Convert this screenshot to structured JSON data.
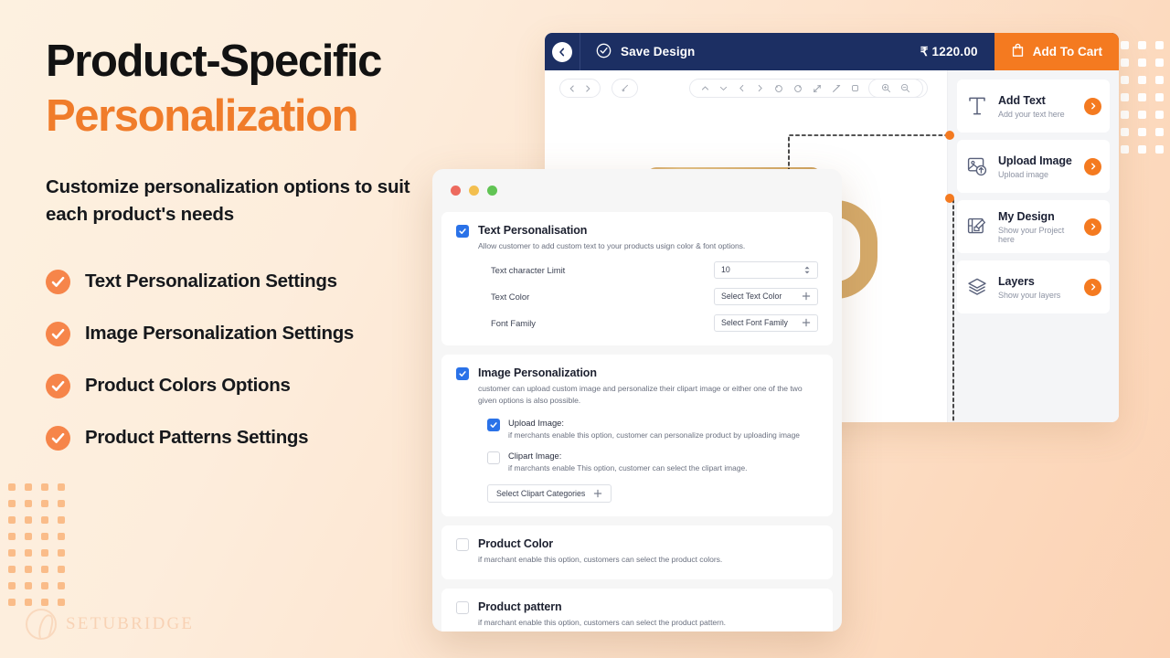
{
  "hero": {
    "headline_line1": "Product-Specific",
    "headline_line2": "Personalization",
    "subheadline": "Customize personalization options to suit each product's needs",
    "accent_color": "#f07c2a",
    "features": [
      {
        "label": "Text Personalization Settings",
        "icon": "check-circle-icon"
      },
      {
        "label": "Image Personalization Settings",
        "icon": "check-circle-icon"
      },
      {
        "label": "Product Colors Options",
        "icon": "check-circle-icon"
      },
      {
        "label": "Product Patterns Settings",
        "icon": "check-circle-icon"
      }
    ],
    "watermark": "SETUBRIDGE"
  },
  "app": {
    "topbar": {
      "back_icon": "chevron-left-icon",
      "save_icon": "cloud-check-icon",
      "save_label": "Save Design",
      "price": "₹ 1220.00",
      "cart_icon": "shopping-bag-icon",
      "cart_label": "Add To Cart",
      "bar_color": "#1c2f63",
      "cart_color": "#f47a20"
    },
    "toolbar": {
      "nav_icons": [
        "chevron-left-icon",
        "chevron-right-icon"
      ],
      "brush_icon": "brush-icon",
      "edit_icons": [
        "chevron-up-icon",
        "chevron-down-icon",
        "chevron-left-icon",
        "chevron-right-icon",
        "rotate-left-icon",
        "rotate-right-icon",
        "expand-diagonal-icon",
        "shrink-diagonal-icon",
        "square-icon",
        "copy-icon",
        "flip-vertical-icon",
        "flip-horizontal-icon"
      ],
      "zoom_icons": [
        "zoom-in-icon",
        "zoom-out-icon"
      ]
    },
    "panel_items": [
      {
        "title": "Add Text",
        "subtitle": "Add your text here",
        "icon": "text-tool-icon",
        "arrow": "chevron-right-icon"
      },
      {
        "title": "Upload Image",
        "subtitle": "Upload image",
        "icon": "image-upload-icon",
        "arrow": "chevron-right-icon"
      },
      {
        "title": "My Design",
        "subtitle": "Show your Project here",
        "icon": "blueprint-icon",
        "arrow": "chevron-right-icon"
      },
      {
        "title": "Layers",
        "subtitle": "Show your layers",
        "icon": "layers-icon",
        "arrow": "chevron-right-icon"
      }
    ],
    "product": {
      "name": "mug",
      "color": "#d5aa6a"
    }
  },
  "settings": {
    "window_dots": [
      "#ed6a5e",
      "#f3bf4f",
      "#61c454"
    ],
    "sections": [
      {
        "id": "text-personalisation",
        "checked": true,
        "title": "Text Personalisation",
        "description": "Allow customer to add custom text to your products usign color & font options.",
        "fields": [
          {
            "label": "Text character Limit",
            "value": "10",
            "control": "stepper",
            "icon": "stepper-arrows-icon"
          },
          {
            "label": "Text Color",
            "value": "Select Text Color",
            "control": "picker",
            "icon": "plus-icon"
          },
          {
            "label": "Font Family",
            "value": "Select Font Family",
            "control": "picker",
            "icon": "plus-icon"
          }
        ]
      },
      {
        "id": "image-personalization",
        "checked": true,
        "title": "Image Personalization",
        "description": "customer can upload custom image and personalize their clipart image or either one of the two given options is also possible.",
        "options": [
          {
            "checked": true,
            "title": "Upload Image:",
            "description": "if merchants enable this option, customer can personalize product by uploading image"
          },
          {
            "checked": false,
            "title": "Clipart Image:",
            "description": "if marchants enable This option, customer can select the clipart image."
          }
        ],
        "button": {
          "label": "Select Clipart Categories",
          "icon": "plus-icon"
        }
      },
      {
        "id": "product-color",
        "checked": false,
        "title": "Product Color",
        "description": "if marchant enable this option, customers can select the product colors."
      },
      {
        "id": "product-pattern",
        "checked": false,
        "title": "Product pattern",
        "description": "if marchant enable this option, customers can select the product pattern."
      }
    ]
  }
}
